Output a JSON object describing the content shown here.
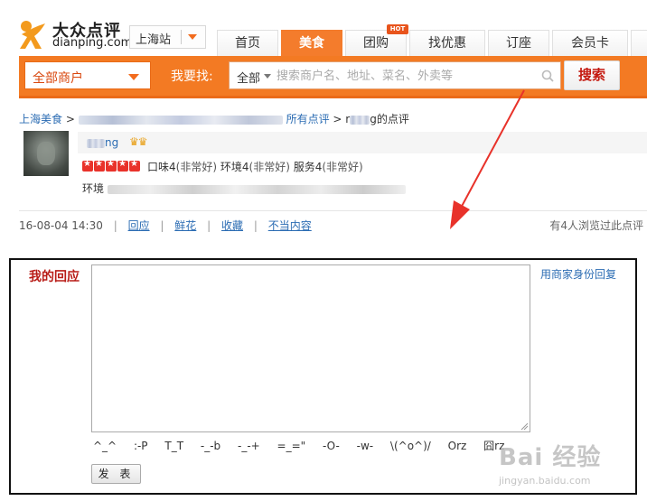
{
  "header": {
    "logo_cn": "大众点评",
    "logo_en": "dianping.com",
    "city": "上海站",
    "nav": [
      {
        "label": "首页",
        "active": false
      },
      {
        "label": "美食",
        "active": true
      },
      {
        "label": "团购",
        "active": false,
        "badge": "HOT"
      },
      {
        "label": "找优惠",
        "active": false
      },
      {
        "label": "订座",
        "active": false
      },
      {
        "label": "会员卡",
        "active": false
      }
    ]
  },
  "search": {
    "category": "全部商户",
    "find_label": "我要找:",
    "scope": "全部",
    "placeholder": "搜索商户名、地址、菜名、外卖等",
    "button": "搜索"
  },
  "breadcrumb": {
    "root": "上海美食",
    "sep": ">",
    "all_reviews": "所有点评",
    "current_prefix": "r",
    "current_suffix": "g的点评"
  },
  "review": {
    "user_partial": "ng",
    "scores": [
      {
        "name": "口味",
        "value": "4",
        "note": "(非常好)"
      },
      {
        "name": "环境",
        "value": "4",
        "note": "(非常好)"
      },
      {
        "name": "服务",
        "value": "4",
        "note": "(非常好)"
      }
    ],
    "text_start": "环境"
  },
  "actions": {
    "time": "16-08-04 14:30",
    "reply": "回应",
    "flower": "鲜花",
    "favorite": "收藏",
    "report": "不当内容",
    "sep": "|",
    "viewed": "有4人浏览过此点评"
  },
  "reply_box": {
    "label": "我的回应",
    "merchant_link": "用商家身份回复",
    "emoticons": [
      "^_^",
      ":-P",
      "T_T",
      "-_-b",
      "-_-+",
      "=_=\"",
      "-O-",
      "-w-",
      "\\(^o^)/",
      "Orz",
      "囧rz"
    ],
    "submit": "发 表"
  },
  "watermark": {
    "big": "Bai 经验",
    "small": "jingyan.baidu.com"
  },
  "colors": {
    "brand_orange": "#f37a23",
    "link_blue": "#2b6cb3",
    "accent_red": "#c4190f"
  }
}
